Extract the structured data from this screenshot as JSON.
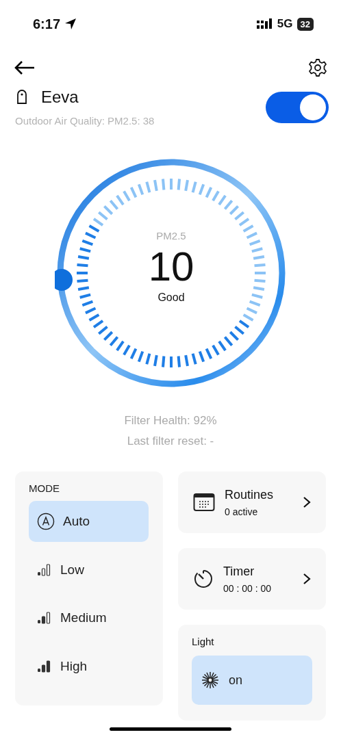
{
  "status_bar": {
    "time": "6:17",
    "network": "5G",
    "battery": "32"
  },
  "device": {
    "name": "Eeva",
    "outdoor": "Outdoor Air Quality: PM2.5: 38",
    "power_on": true
  },
  "dial": {
    "label": "PM2.5",
    "value": "10",
    "rating": "Good"
  },
  "filter": {
    "health": "Filter Health: 92%",
    "last_reset": "Last filter reset: -"
  },
  "mode": {
    "title": "MODE",
    "items": [
      {
        "label": "Auto",
        "kind": "auto",
        "selected": true
      },
      {
        "label": "Low",
        "kind": "low",
        "selected": false
      },
      {
        "label": "Medium",
        "kind": "medium",
        "selected": false
      },
      {
        "label": "High",
        "kind": "high",
        "selected": false
      }
    ]
  },
  "routines": {
    "title": "Routines",
    "subtitle": "0 active"
  },
  "timer": {
    "title": "Timer",
    "subtitle": "00 : 00 : 00"
  },
  "light": {
    "title": "Light",
    "state": "on",
    "on": true
  }
}
